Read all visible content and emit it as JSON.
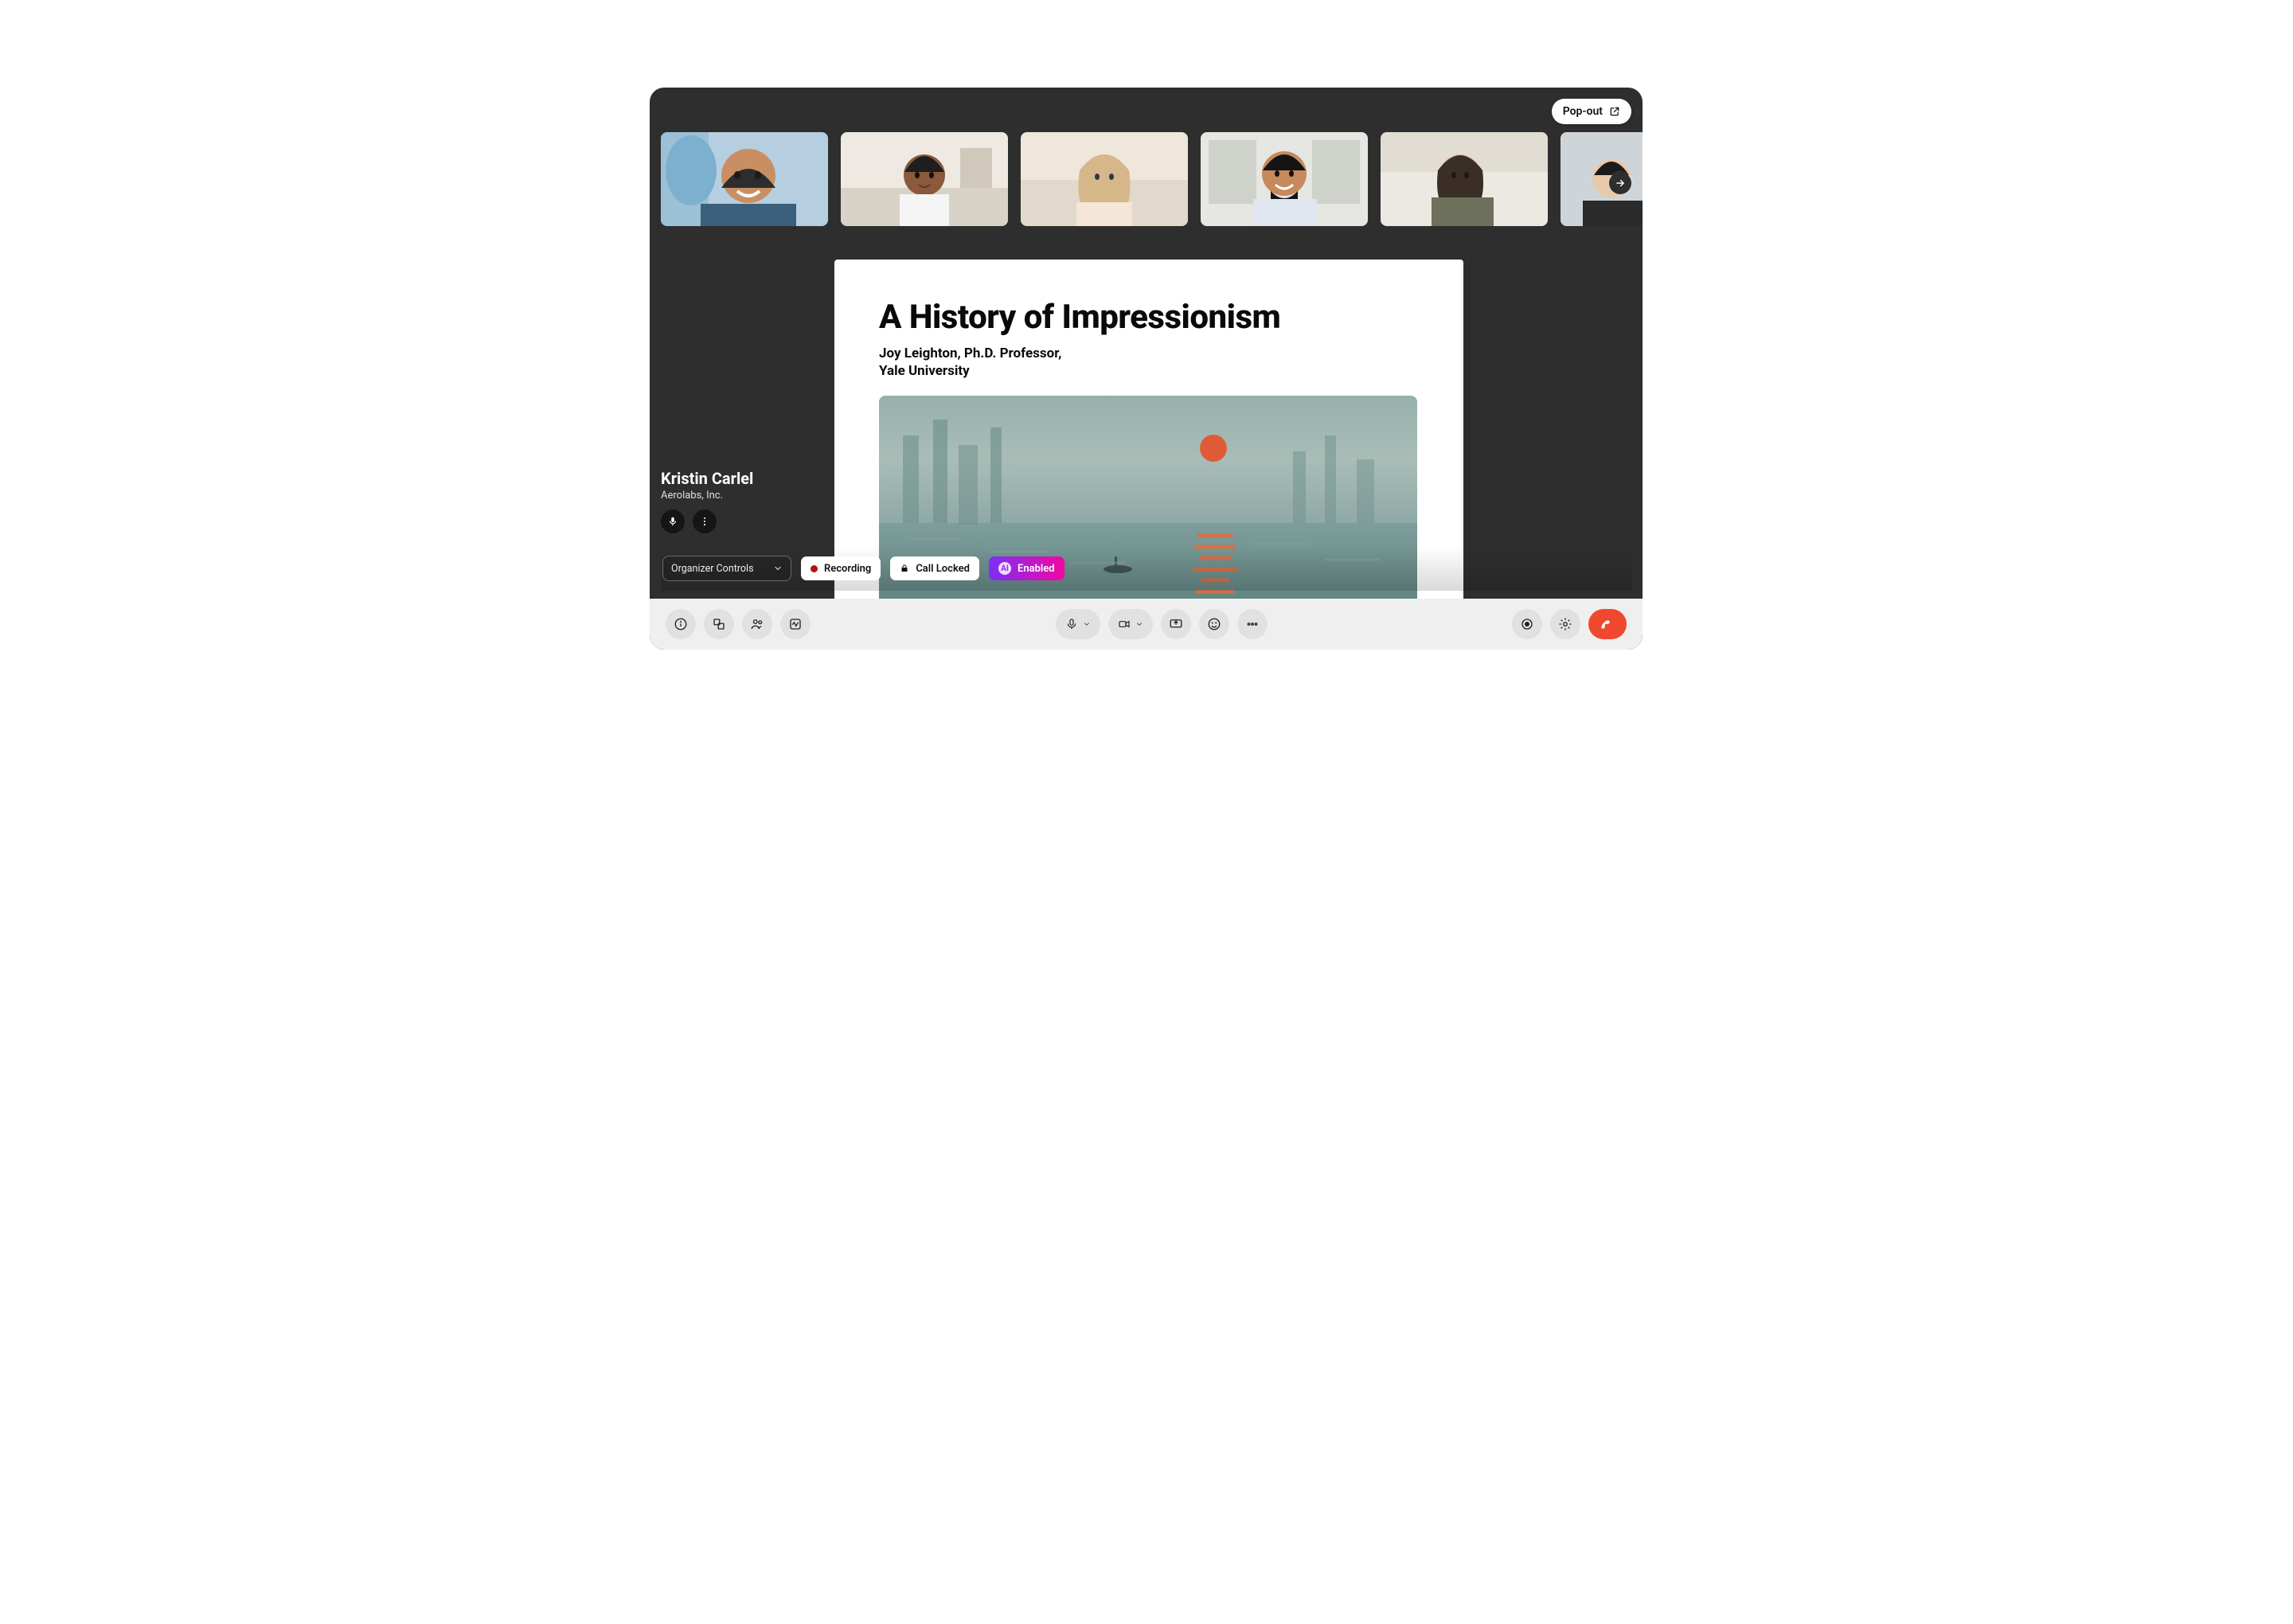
{
  "popout": {
    "label": "Pop-out"
  },
  "slide": {
    "title": "A History of Impressionism",
    "byline_line1": "Joy Leighton, Ph.D. Professor,",
    "byline_line2": "Yale University"
  },
  "presenter": {
    "name": "Kristin Carlel",
    "org": "Aerolabs, Inc."
  },
  "status": {
    "organizer_controls_label": "Organizer Controls",
    "recording_label": "Recording",
    "call_locked_label": "Call Locked",
    "enabled_label": "Enabled",
    "enabled_badge": "AI"
  },
  "participants": {
    "visible_count": 6,
    "has_more": true
  },
  "colors": {
    "app_bg": "#2e2e2e",
    "toolbar_bg": "#efefef",
    "hangup": "#f0482e",
    "recording_dot": "#b11212",
    "enabled_gradient_from": "#7b2ff7",
    "enabled_gradient_to": "#f107a3"
  }
}
